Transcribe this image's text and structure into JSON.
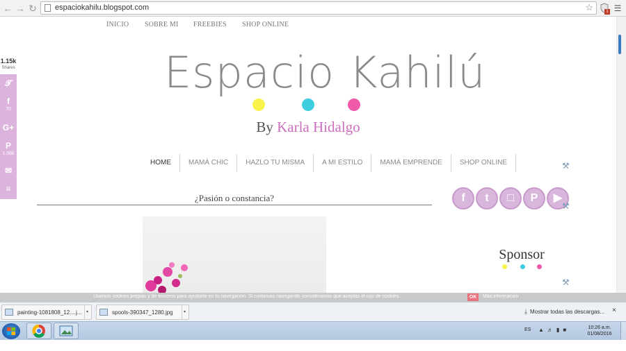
{
  "browser": {
    "url": "espaciokahilu.blogspot.com",
    "extension_badge": "1"
  },
  "blog": {
    "top_nav": [
      "INICIO",
      "SOBRE MI",
      "FREEBIES",
      "SHOP ONLINE"
    ],
    "title": "Espacio Kahilú",
    "byline_prefix": "By ",
    "author": "Karla Hidalgo",
    "dot_colors": [
      "#f7f34a",
      "#3dcfe0",
      "#ef5aa9"
    ],
    "main_nav": [
      "HOME",
      "MAMÀ CHIC",
      "HAZLO TU MISMA",
      "A MI ESTILO",
      "MAMÀ EMPRENDE",
      "SHOP ONLINE"
    ],
    "post_title": "¿Pasión o constancia?",
    "sponsor_heading": "Sponsor",
    "social_icons": [
      "facebook-icon",
      "twitter-icon",
      "instagram-icon",
      "pinterest-icon",
      "youtube-icon"
    ]
  },
  "share_bar": {
    "total": "1.15k",
    "label": "Shares",
    "buttons": [
      {
        "icon": "twitter-icon",
        "count": ""
      },
      {
        "icon": "facebook-icon",
        "count": "70"
      },
      {
        "icon": "google-plus-icon",
        "count": ""
      },
      {
        "icon": "pinterest-icon",
        "count": "1.08k"
      },
      {
        "icon": "email-icon",
        "count": ""
      },
      {
        "icon": "more-share-icon",
        "count": ""
      }
    ]
  },
  "cookie_bar": {
    "message": "Usamos cookies propias y de terceros para ayudarte en tu navegación. Si continuas navegando consideramos que aceptas el uso de cookies.",
    "ok": "OK",
    "more": "Más información"
  },
  "downloads": {
    "items": [
      "painting-1081808_12....j...",
      "spools-390347_1280.jpg"
    ],
    "show_all": "Mostrar todas las descargas...",
    "close": "×"
  },
  "taskbar": {
    "lang": "ES",
    "time": "10:26 a.m.",
    "date": "01/08/2016"
  },
  "colors": {
    "accent_pink": "#cc6fbd",
    "share_bar": "#dcb3dd"
  }
}
